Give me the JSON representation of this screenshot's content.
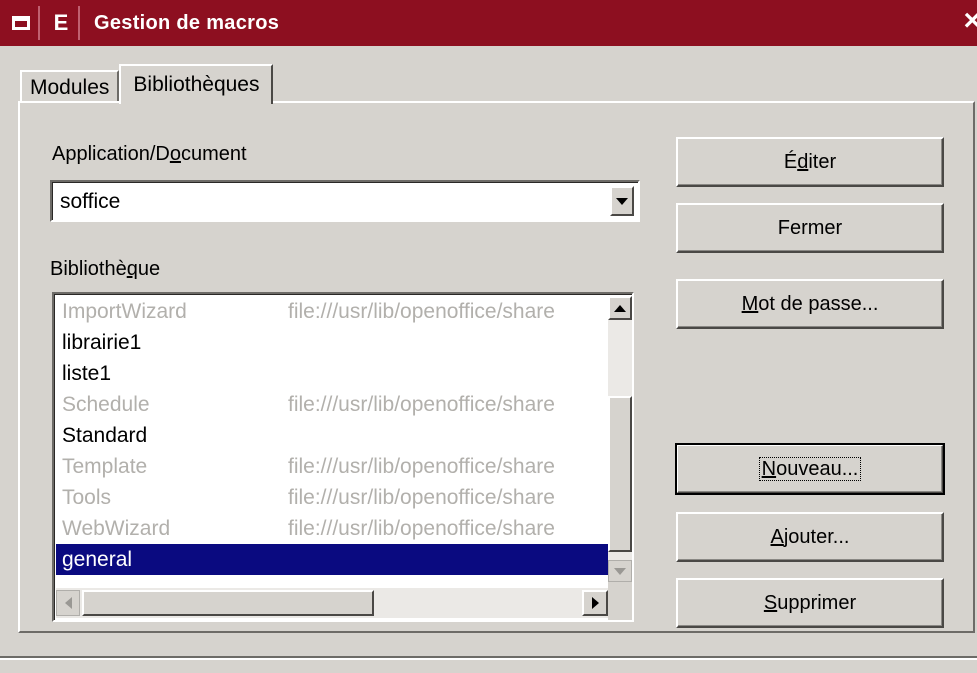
{
  "window": {
    "title": "Gestion de macros",
    "icon_letter": "E",
    "close_glyph": "×"
  },
  "tabs": [
    {
      "label": "Modules"
    },
    {
      "label": "Bibliothèques"
    }
  ],
  "app_doc": {
    "label_pre": "Application/D",
    "label_ul": "o",
    "label_post": "cument",
    "selected": "soffice"
  },
  "library": {
    "label_pre": "Bibliothè",
    "label_ul": "q",
    "label_post": "ue",
    "items": [
      {
        "name": "ImportWizard",
        "path": "file:///usr/lib/openoffice/share"
      },
      {
        "name": "librairie1",
        "path": ""
      },
      {
        "name": "liste1",
        "path": ""
      },
      {
        "name": "Schedule",
        "path": "file:///usr/lib/openoffice/share"
      },
      {
        "name": "Standard",
        "path": ""
      },
      {
        "name": "Template",
        "path": "file:///usr/lib/openoffice/share"
      },
      {
        "name": "Tools",
        "path": "file:///usr/lib/openoffice/share"
      },
      {
        "name": "WebWizard",
        "path": "file:///usr/lib/openoffice/share"
      },
      {
        "name": "general",
        "path": ""
      }
    ]
  },
  "buttons": {
    "edit": {
      "pre": "É",
      "ul": "d",
      "post": "iter"
    },
    "close": {
      "label": "Fermer"
    },
    "password": {
      "pre": "",
      "ul": "M",
      "post": "ot de passe..."
    },
    "new": {
      "pre": "",
      "ul": "N",
      "post": "ouveau..."
    },
    "add": {
      "pre": "",
      "ul": "A",
      "post": "jouter..."
    },
    "delete": {
      "pre": "",
      "ul": "S",
      "post": "upprimer"
    }
  }
}
